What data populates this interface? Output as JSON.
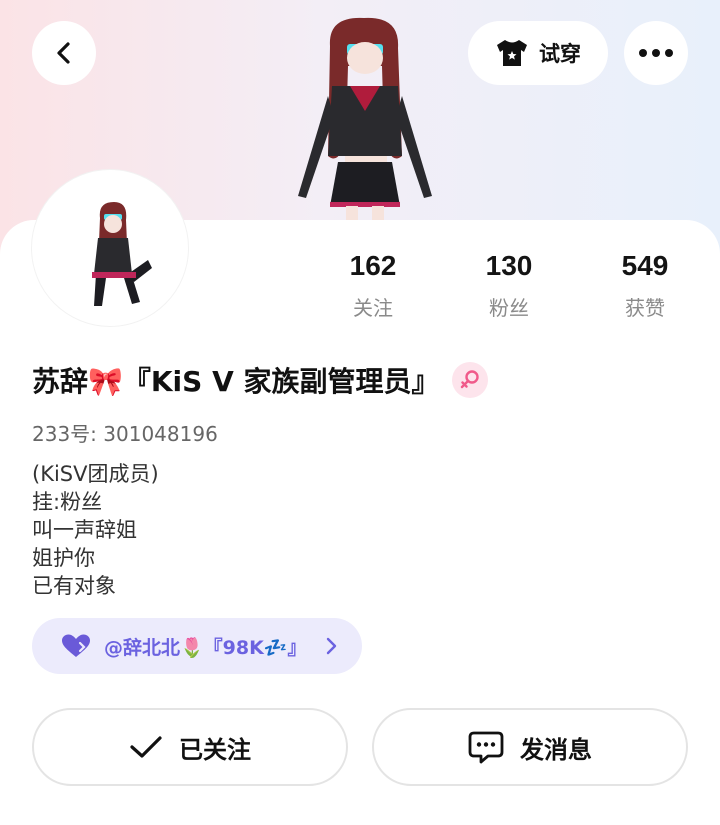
{
  "header": {
    "back_icon": "chevron-left-icon",
    "try_on_label": "试穿",
    "try_on_icon": "shirt-icon",
    "more_icon": "more-dots-icon"
  },
  "stats": [
    {
      "value": "162",
      "label": "关注"
    },
    {
      "value": "130",
      "label": "粉丝"
    },
    {
      "value": "549",
      "label": "获赞"
    }
  ],
  "profile": {
    "name": "苏辞🎀『KiS V 家族副管理员』",
    "gender_icon": "female-icon",
    "uid": "233号: 301048196",
    "bio": [
      "(KiSV团成员)",
      "挂:粉丝",
      "叫一声辞姐",
      "姐护你",
      "已有对象"
    ]
  },
  "link_chip": {
    "icon": "heart-icon",
    "text": "@辞北北🌷『98K💤』",
    "chevron": "chevron-right-icon"
  },
  "actions": {
    "follow_label": "已关注",
    "message_label": "发消息"
  },
  "colors": {
    "accent": "#6b62e0",
    "chip_bg": "#ecebfc",
    "heart": "#6a5ad8",
    "female": "#f05a8a"
  }
}
